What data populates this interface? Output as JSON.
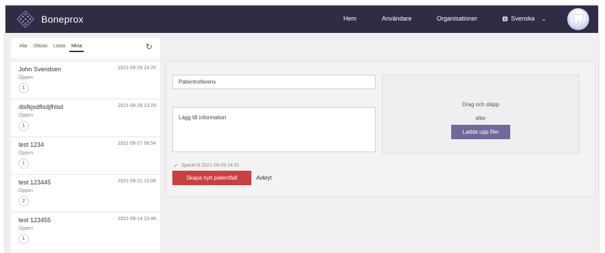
{
  "app": {
    "brand_name": "Boneprox"
  },
  "nav": {
    "home": "Hem",
    "users": "Användare",
    "organizations": "Organisationer",
    "language": "Svenska"
  },
  "sidebar": {
    "tabs": [
      {
        "label": "Alla",
        "active": false
      },
      {
        "label": "Olästa",
        "active": false
      },
      {
        "label": "Lästa",
        "active": false
      },
      {
        "label": "Mina",
        "active": true
      }
    ],
    "cases": [
      {
        "name": "John Svendsen",
        "date": "2021-09-29 14:25",
        "status": "Öppen",
        "count": "1"
      },
      {
        "name": "dlsfkjsdflsdjfhlsd",
        "date": "2021-09-28 13:29",
        "status": "Öppen",
        "count": "1"
      },
      {
        "name": "test 1234",
        "date": "2021-09-27 08:54",
        "status": "Öppen",
        "count": "1"
      },
      {
        "name": "test 123445",
        "date": "2021-09-21 10:08",
        "status": "Öppen",
        "count": "2"
      },
      {
        "name": "test 123455",
        "date": "2021-09-14 10:48",
        "status": "Öppen",
        "count": "1"
      }
    ]
  },
  "form": {
    "reference_placeholder": "Patientreferens",
    "info_placeholder": "Lägg till information",
    "drop_text": "Drag och släpp",
    "or_text": "eller",
    "upload_label": "Ladda upp filer",
    "saved_text": "Sparat kl 2021-09-29 14:31",
    "create_label": "Skapa nytt patientfall",
    "cancel_label": "Avbryt"
  },
  "colors": {
    "topbar": "#2f2d45",
    "primary_button": "#c94040",
    "upload_button": "#6e6a9a"
  }
}
